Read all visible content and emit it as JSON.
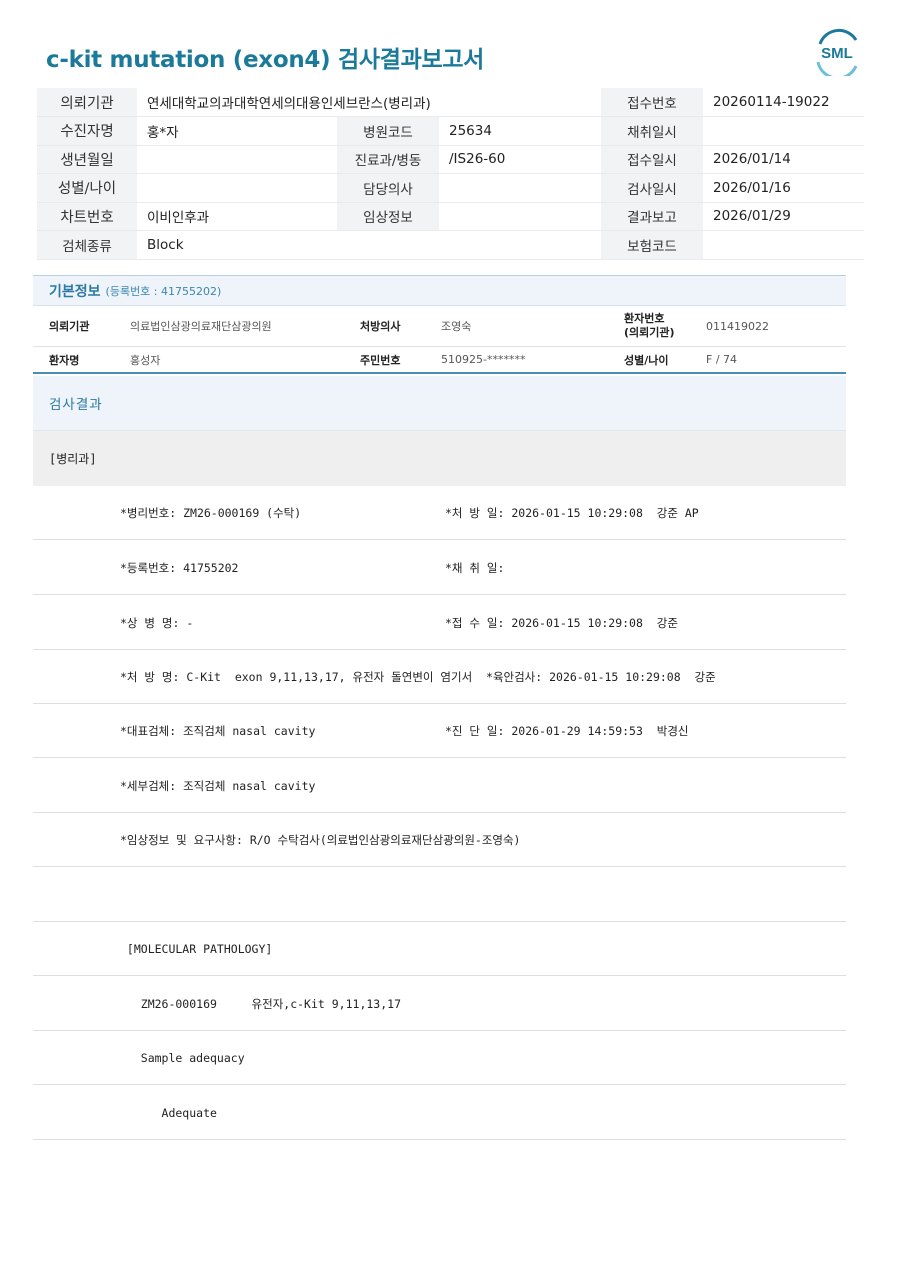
{
  "report": {
    "title": "c-kit mutation (exon4) 검사결과보고서",
    "logo_text": "SML",
    "brand_color": "#1b7a9a"
  },
  "info": {
    "rows": [
      [
        "의뢰기관",
        "연세대학교의과대학연세의대용인세브란스(병리과)",
        "",
        "",
        "접수번호",
        "20260114-19022"
      ],
      [
        "수진자명",
        "홍*자",
        "병원코드",
        "25634",
        "채취일시",
        ""
      ],
      [
        "생년월일",
        "",
        "진료과/병동",
        "/IS26-60",
        "접수일시",
        "2026/01/14"
      ],
      [
        "성별/나이",
        "",
        "담당의사",
        "",
        "검사일시",
        "2026/01/16"
      ],
      [
        "차트번호",
        "이비인후과",
        "임상정보",
        "",
        "결과보고",
        "2026/01/29"
      ],
      [
        "검체종류",
        "Block",
        "",
        "",
        "보험코드",
        ""
      ]
    ]
  },
  "basic": {
    "heading": "기본정보",
    "reg_label": "(등록번호 : 41755202)",
    "r1": {
      "k1": "의뢰기관",
      "v1": "의료법인삼광의료재단삼광의원",
      "k2": "처방의사",
      "v2": "조영숙",
      "k3a": "환자번호",
      "k3b": "(의뢰기관)",
      "v3": "011419022"
    },
    "r2": {
      "k1": "환자명",
      "v1": "홍성자",
      "k2": "주민번호",
      "v2": "510925-*******",
      "k3": "성별/나이",
      "v3": "F / 74"
    }
  },
  "result": {
    "heading": "검사결과",
    "dept": "[병리과]",
    "lines": [
      {
        "a": "*병리번호: ZM26-000169 (수탁)",
        "b": "*처 방 일: 2026-01-15 10:29:08  강준 AP"
      },
      {
        "a": "*등록번호: 41755202",
        "b": "*채 취 일:"
      },
      {
        "a": "*상 병 명: -",
        "b": "*접 수 일: 2026-01-15 10:29:08  강준"
      },
      {
        "a": "*처 방 명: C-Kit  exon 9,11,13,17, 유전자 돌연변이 염기서  *육안검사: 2026-01-15 10:29:08  강준",
        "b": ""
      },
      {
        "a": "*대표검체: 조직검체 nasal cavity",
        "b": "*진 단 일: 2026-01-29 14:59:53  박경신"
      },
      {
        "a": "*세부검체: 조직검체 nasal cavity",
        "b": ""
      },
      {
        "a": "*임상정보 및 요구사항: R/O 수탁검사(의료법인삼광의료재단삼광의원-조영숙)",
        "b": ""
      },
      {
        "a": "",
        "b": ""
      },
      {
        "a": " [MOLECULAR PATHOLOGY]",
        "b": ""
      },
      {
        "a": "   ZM26-000169     유전자,c-Kit 9,11,13,17",
        "b": ""
      },
      {
        "a": "   Sample adequacy",
        "b": ""
      },
      {
        "a": "      Adequate",
        "b": ""
      }
    ]
  }
}
